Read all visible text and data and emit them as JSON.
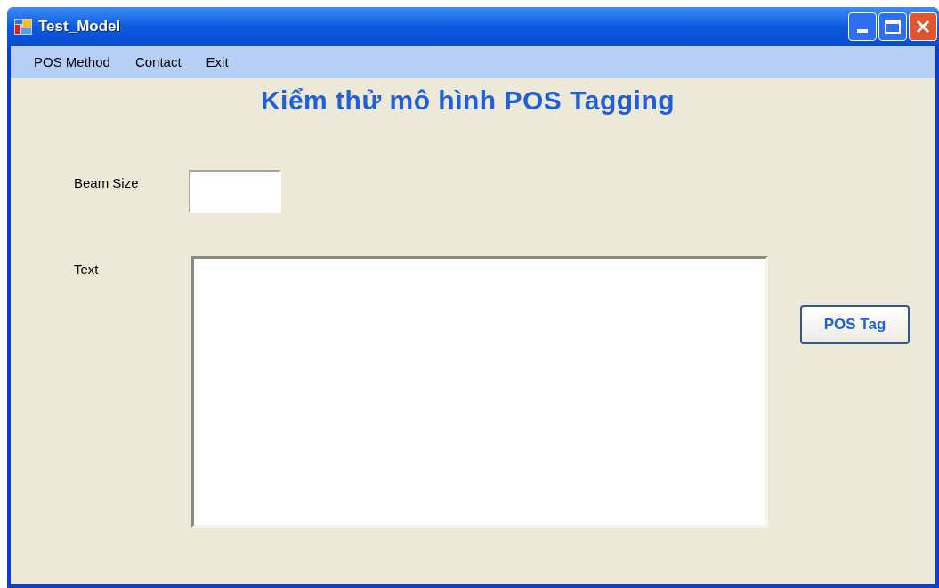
{
  "window": {
    "title": "Test_Model"
  },
  "menu": [
    {
      "label": "POS Method"
    },
    {
      "label": "Contact"
    },
    {
      "label": "Exit"
    }
  ],
  "heading": "Kiểm thử mô hình POS Tagging",
  "beam_size": {
    "label": "Beam Size"
  },
  "text": {
    "label": "Text"
  },
  "buttons": [
    {
      "label": "POS Tag"
    }
  ]
}
